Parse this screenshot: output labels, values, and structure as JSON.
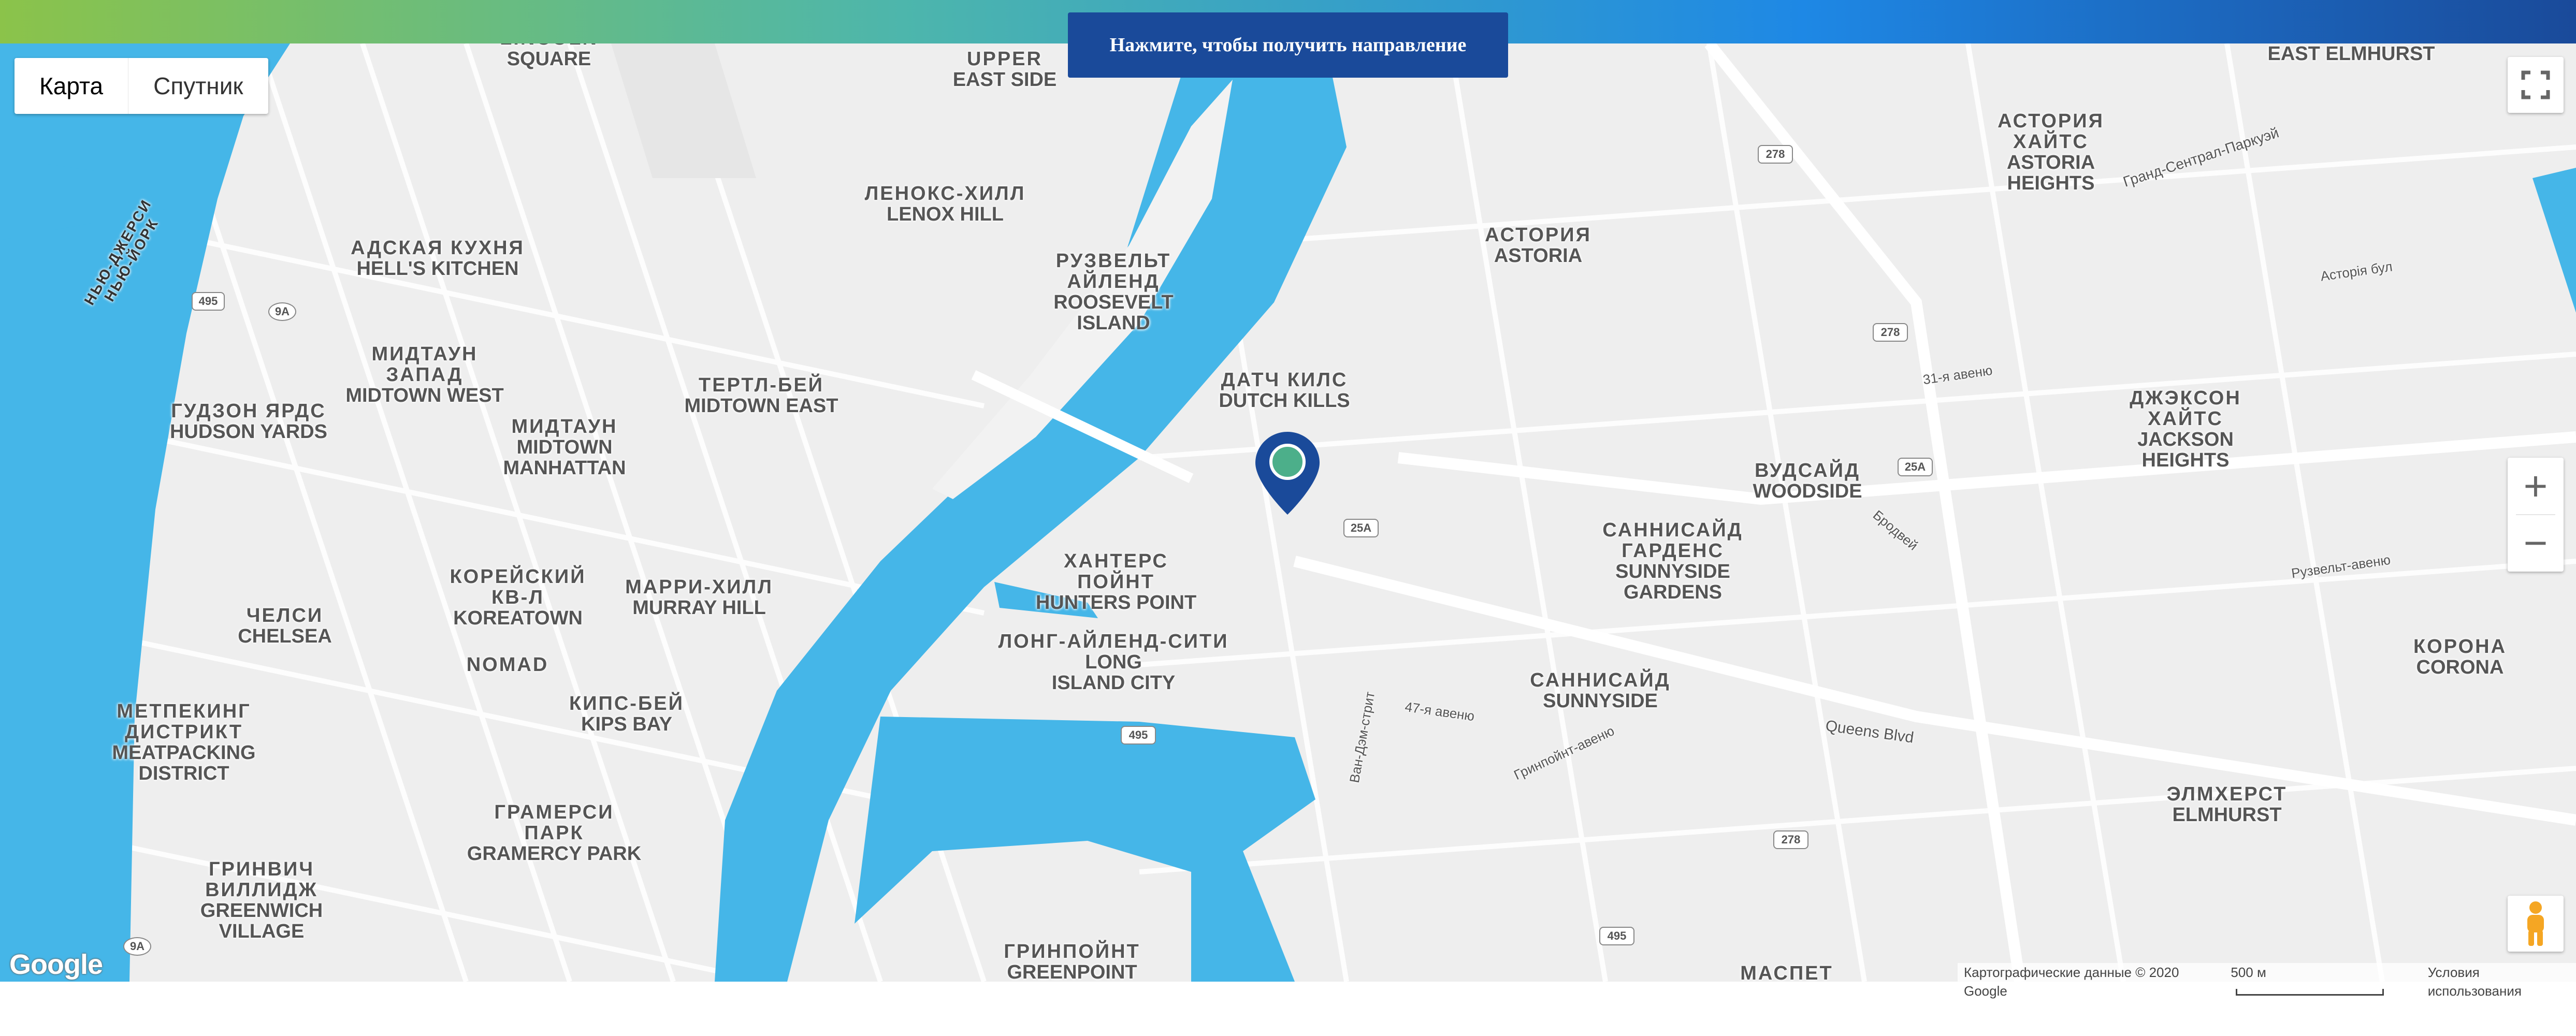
{
  "header": {
    "directions_button": "Нажмите, чтобы получить направление"
  },
  "map_type": {
    "options": [
      "Карта",
      "Спутник"
    ],
    "selected": "Карта"
  },
  "controls": {
    "fullscreen_icon": "fullscreen-icon",
    "zoom_in": "+",
    "zoom_out": "−",
    "pegman_icon": "pegman-icon"
  },
  "attribution": {
    "logo": "Google",
    "map_data": "Картографические данные © 2020 Google",
    "scale": "500 м",
    "terms": "Условия использования"
  },
  "neighborhoods": [
    {
      "ru": "LINCOLN",
      "en": "SQUARE"
    },
    {
      "ru": "UPPER",
      "en": "EAST SIDE"
    },
    {
      "ru": "",
      "en": "EAST ELMHURST"
    },
    {
      "ru": "АСТОРИЯ\nХАЙТС",
      "en": "ASTORIA\nHEIGHTS"
    },
    {
      "ru": "ЛЕНОКС-ХИЛЛ",
      "en": "LENOX HILL"
    },
    {
      "ru": "АДСКАЯ КУХНЯ",
      "en": "HELL'S KITCHEN"
    },
    {
      "ru": "РУЗВЕЛЬТ\nАЙЛЕНД",
      "en": "ROOSEVELT\nISLAND"
    },
    {
      "ru": "АСТОРИЯ",
      "en": "ASTORIA"
    },
    {
      "ru": "МИДТАУН\nЗАПАД",
      "en": "MIDTOWN WEST"
    },
    {
      "ru": "ТЕРТЛ-БЕЙ",
      "en": "MIDTOWN EAST"
    },
    {
      "ru": "ДАТЧ КИЛС",
      "en": "DUTCH KILLS"
    },
    {
      "ru": "ДЖЭКСОН\nХАЙТС",
      "en": "JACKSON\nHEIGHTS"
    },
    {
      "ru": "ГУДЗОН ЯРДС",
      "en": "HUDSON YARDS"
    },
    {
      "ru": "МИДТАУН",
      "en": "MIDTOWN\nMANHATTAN"
    },
    {
      "ru": "ВУДСАЙД",
      "en": "WOODSIDE"
    },
    {
      "ru": "САННИСАЙД\nГАРДЕНС",
      "en": "SUNNYSIDE\nGARDENS"
    },
    {
      "ru": "ХАНТЕРС\nПОЙНТ",
      "en": "HUNTERS POINT"
    },
    {
      "ru": "КОРЕЙСКИЙ\nКВ-Л",
      "en": "KOREATOWN"
    },
    {
      "ru": "МАРРИ-ХИЛЛ",
      "en": "MURRAY HILL"
    },
    {
      "ru": "ЧЕЛСИ",
      "en": "CHELSEA"
    },
    {
      "ru": "ЛОНГ-АЙЛЕНД-СИТИ",
      "en": "LONG\nISLAND CITY"
    },
    {
      "ru": "КОРОНА",
      "en": "CORONA"
    },
    {
      "ru": "NOMAD",
      "en": ""
    },
    {
      "ru": "САННИСАЙД",
      "en": "SUNNYSIDE"
    },
    {
      "ru": "МЕТПЕКИНГ\nДИСТРИКТ",
      "en": "MEATPACKING\nDISTRICT"
    },
    {
      "ru": "КИПС-БЕЙ",
      "en": "KIPS BAY"
    },
    {
      "ru": "ЭЛМХЕРСТ",
      "en": "ELMHURST"
    },
    {
      "ru": "ГРАМЕРСИ\nПАРК",
      "en": "GRAMERCY PARK"
    },
    {
      "ru": "ГРИНВИЧ\nВИЛЛИДЖ",
      "en": "GREENWICH\nVILLAGE"
    },
    {
      "ru": "ГРИНПОЙНТ",
      "en": "GREENPOINT"
    },
    {
      "ru": "МАСПЕТ",
      "en": ""
    }
  ],
  "water_labels": [
    "НЬЮ-ДЖЕРСИ\nНЬЮ-ЙОРК"
  ],
  "street_labels": [
    "Queens Blvd",
    "Гранд-Сентрал-Паркуэй",
    "47-я авеню",
    "Ван-Дэм-стрит",
    "Гринпойнт-авеню",
    "Бродвей",
    "Рузвельт-авеню",
    "Асторія бул",
    "31-я авеню"
  ],
  "route_shields": [
    "495",
    "9A",
    "25A",
    "278",
    "495",
    "278",
    "25A",
    "278",
    "495",
    "9A"
  ],
  "colors": {
    "water": "#45b6e8",
    "land": "#eeeeee",
    "road": "#ffffff",
    "marker": "#1a4a9a",
    "marker_center": "#4caf8a",
    "button": "#1a4a9a"
  }
}
